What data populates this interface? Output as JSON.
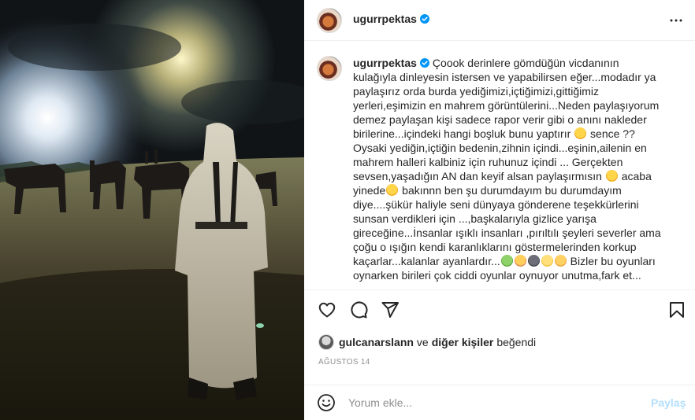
{
  "post": {
    "username": "ugurrpektas",
    "verified_icon": "verified-badge-icon",
    "accent_color": "#0095f6",
    "caption_lines": [
      "Çoook derinlere gömdüğün vicdanının",
      "kulağıyla dinleyesin istersen ve yapabilirsen eğer...modadır ya",
      "paylaşırız orda burda yediğimizi,içtiğimizi,gittiğimiz",
      "yerleri,eşimizin en mahrem görüntülerini...Neden paylaşıyorum",
      "demez paylaşan kişi sadece rapor verir gibi o anını nakleder",
      "birilerine...içindeki hangi boşluk bunu yaptırır",
      "sence ??",
      "Oysaki yediğin,içtiğin bedenin,zihnin içindi...eşinin,ailenin en",
      "mahrem halleri kalbiniz için ruhunuz içindi ... Gerçekten",
      "sevsen,yaşadığın AN dan keyif alsan paylaşırmısın",
      "acaba",
      "yinede",
      "bakınnn ben şu durumdayım bu durumdayım",
      "diye....şükür haliyle seni dünyaya gönderene teşekkürlerini",
      "sunsan verdikleri için ...,başkalarıyla gizlice yarışa",
      "gireceğine...İnsanlar ışıklı insanları ,pırıltılı şeyleri severler ama",
      "çoğu o ışığın kendi karanlıklarını göstermelerinden korkup",
      "kaçarlar...kalanlar ayanlardır...",
      "Bizler bu oyunları",
      "oynarken birileri çok ciddi oyunlar oynuyor unutma,fark et..."
    ],
    "liked_by_user": "gulcanarslann",
    "liked_connector": "ve",
    "liked_others": "diğer kişiler",
    "liked_suffix": "beğendi",
    "date": "AĞUSTOS 14",
    "comment_placeholder": "Yorum ekle...",
    "post_button": "Paylaş"
  }
}
